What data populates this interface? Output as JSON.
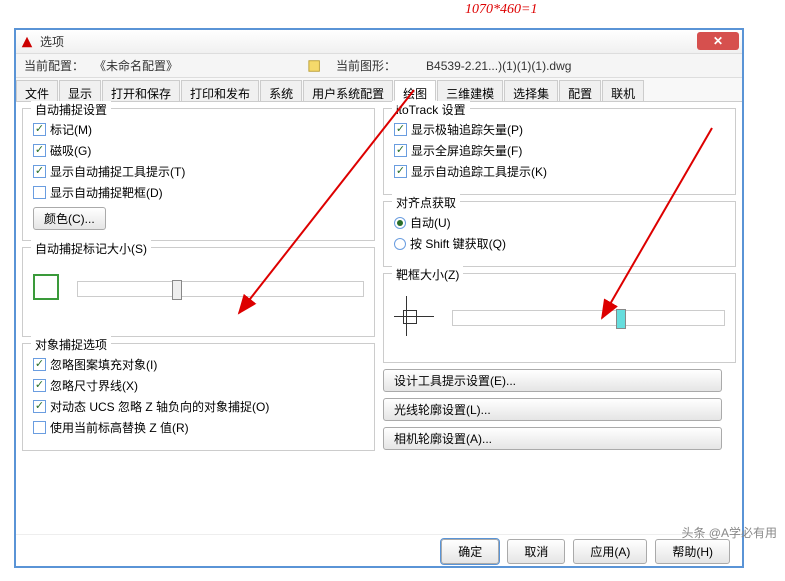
{
  "topNote": "1070*460=1",
  "watermark": "头条 @A学必有用",
  "dialog": {
    "title": "选项",
    "profile": {
      "currentProfileLabel": "当前配置：",
      "currentProfileValue": "《未命名配置》",
      "currentDrawingLabel": "当前图形：",
      "currentDrawingValue": "B4539-2.21...)(1)(1)(1).dwg"
    },
    "tabs": [
      "文件",
      "显示",
      "打开和保存",
      "打印和发布",
      "系统",
      "用户系统配置",
      "绘图",
      "三维建模",
      "选择集",
      "配置",
      "联机"
    ],
    "activeTabIndex": 6,
    "groups": {
      "autosnapSettings": {
        "legend": "自动捕捉设置",
        "marker": "标记(M)",
        "magnet": "磁吸(G)",
        "tooltip": "显示自动捕捉工具提示(T)",
        "aperture": "显示自动捕捉靶框(D)",
        "colorBtn": "颜色(C)..."
      },
      "markerSize": {
        "legend": "自动捕捉标记大小(S)"
      },
      "osnapOptions": {
        "legend": "对象捕捉选项",
        "ignoreHatch": "忽略图案填充对象(I)",
        "ignoreExt": "忽略尺寸界线(X)",
        "dynUCS": "对动态 UCS 忽略 Z 轴负向的对象捕捉(O)",
        "replaceZ": "使用当前标高替换 Z 值(R)"
      },
      "autotrack": {
        "legend": "itoTrack 设置",
        "polar": "显示极轴追踪矢量(P)",
        "fullscreen": "显示全屏追踪矢量(F)",
        "tooltip": "显示自动追踪工具提示(K)"
      },
      "alignment": {
        "legend": "对齐点获取",
        "auto": "自动(U)",
        "shift": "按 Shift 键获取(Q)"
      },
      "apertureSize": {
        "legend": "靶框大小(Z)"
      },
      "designBtn": "设计工具提示设置(E)...",
      "glowBtn": "光线轮廓设置(L)...",
      "cameraBtn": "相机轮廓设置(A)..."
    },
    "footer": {
      "ok": "确定",
      "cancel": "取消",
      "apply": "应用(A)",
      "help": "帮助(H)"
    }
  }
}
